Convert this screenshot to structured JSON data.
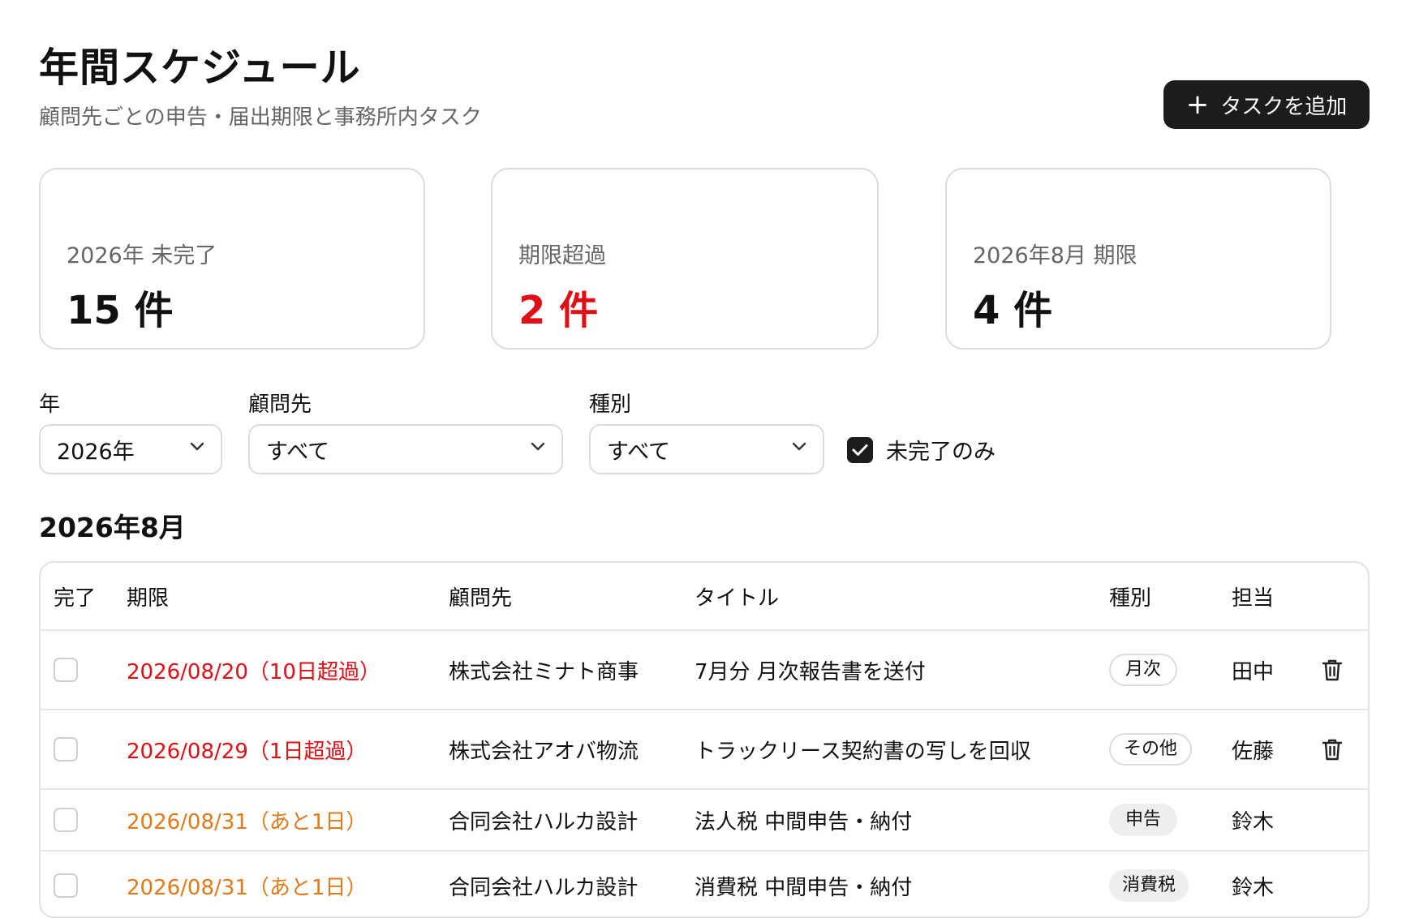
{
  "header": {
    "title": "年間スケジュール",
    "subtitle": "顧問先ごとの申告・届出期限と事務所内タスク",
    "add_button": "タスクを追加"
  },
  "stats": [
    {
      "label": "2026年 未完了",
      "value": "15 件"
    },
    {
      "label": "期限超過",
      "value": "2 件"
    },
    {
      "label": "2026年8月 期限",
      "value": "4 件"
    }
  ],
  "filters": {
    "year_label": "年",
    "year_value": "2026年",
    "client_label": "顧問先",
    "client_value": "すべて",
    "type_label": "種別",
    "type_value": "すべて",
    "incomplete_only_label": "未完了のみ"
  },
  "section": {
    "title": "2026年8月"
  },
  "table": {
    "headers": {
      "done": "完了",
      "deadline": "期限",
      "client": "顧問先",
      "title": "タイトル",
      "type": "種別",
      "assignee": "担当"
    },
    "rows": [
      {
        "deadline": "2026/08/20（10日超過）",
        "client": "株式会社ミナト商事",
        "title": "7月分 月次報告書を送付",
        "type": "月次",
        "assignee": "田中"
      },
      {
        "deadline": "2026/08/29（1日超過）",
        "client": "株式会社アオバ物流",
        "title": "トラックリース契約書の写しを回収",
        "type": "その他",
        "assignee": "佐藤"
      },
      {
        "deadline": "2026/08/31（あと1日）",
        "client": "合同会社ハルカ設計",
        "title": "法人税 中間申告・納付",
        "type": "申告",
        "assignee": "鈴木"
      },
      {
        "deadline": "2026/08/31（あと1日）",
        "client": "合同会社ハルカ設計",
        "title": "消費税 中間申告・納付",
        "type": "消費税",
        "assignee": "鈴木"
      }
    ]
  },
  "colors": {
    "overdue": "#e00e16",
    "soon": "#e07a1a",
    "primary": "#1c1c1c"
  }
}
